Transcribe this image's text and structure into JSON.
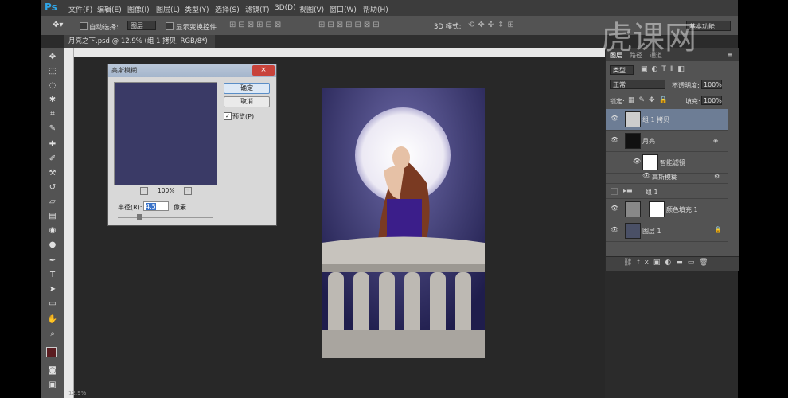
{
  "menu": {
    "logo": "Ps",
    "items": [
      "文件(F)",
      "编辑(E)",
      "图像(I)",
      "图层(L)",
      "类型(Y)",
      "选择(S)",
      "滤镜(T)",
      "3D(D)",
      "视图(V)",
      "窗口(W)",
      "帮助(H)"
    ]
  },
  "options": {
    "auto_select_label": "自动选择:",
    "auto_select_value": "图层",
    "show_transform": "显示变换控件",
    "mode_3d": "3D 模式:",
    "workspace": "基本功能"
  },
  "document": {
    "tab_title": "月亮之下.psd @ 12.9% (组 1 拷贝, RGB/8*) *"
  },
  "dialog": {
    "title": "高斯模糊",
    "ok": "确定",
    "cancel": "取消",
    "preview_label": "预览(P)",
    "zoom": "100%",
    "radius_label": "半径(R):",
    "radius_value": "4.5",
    "unit": "像素"
  },
  "layers_panel": {
    "tabs": [
      "图层",
      "路径",
      "通道"
    ],
    "filter_type": "类型",
    "blend_mode": "正常",
    "opacity_label": "不透明度:",
    "opacity_value": "100%",
    "lock_label": "锁定:",
    "fill_label": "填充:",
    "fill_value": "100%",
    "layers": [
      {
        "name": "组 1 拷贝"
      },
      {
        "name": "月亮"
      },
      {
        "name": "智能滤镜"
      },
      {
        "name": "高斯模糊"
      },
      {
        "name": "组 1"
      },
      {
        "name": "颜色填充 1"
      },
      {
        "name": "图层 1"
      }
    ]
  },
  "watermark": "虎课网",
  "status": "12.9%"
}
